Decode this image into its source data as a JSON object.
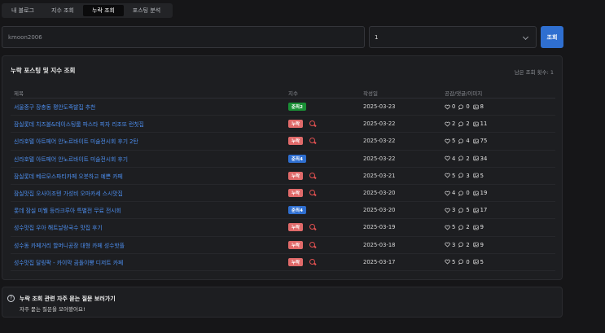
{
  "tabs": [
    {
      "label": "내 블로그"
    },
    {
      "label": "지수 조회"
    },
    {
      "label": "누락 조회"
    },
    {
      "label": "포스팅 분석"
    }
  ],
  "search": {
    "value": "kmoon2006",
    "placeholder": ""
  },
  "select": {
    "value": "1"
  },
  "search_button": "조회",
  "panel": {
    "title": "누락 포스팅 및 지수 조회",
    "remaining": "남은 조회 횟수: 1",
    "columns": [
      "제목",
      "지수",
      "작성일",
      "공감/댓글/이미지"
    ]
  },
  "colors": {
    "rank": "#1a8f35",
    "miss": "#e06a6a",
    "blue": "#2f6fd0",
    "link": "#4d8ff0"
  },
  "rows": [
    {
      "title": "서울중구 장충동 평안도족발집 추천",
      "badge": "준최2",
      "type": "rank",
      "date": "2025-03-23",
      "likes": "0",
      "comments": "0",
      "images": "8"
    },
    {
      "title": "잠실롯데 치즈볼&데이스팅룸 파스타 피자 리조또 런칫집",
      "badge": "누락",
      "type": "miss",
      "date": "2025-03-22",
      "likes": "2",
      "comments": "2",
      "images": "11"
    },
    {
      "title": "신라호텔 아트페어 안노르바이트 미술전시회 후기 2탄",
      "badge": "누락",
      "type": "miss",
      "date": "2025-03-22",
      "likes": "5",
      "comments": "4",
      "images": "75"
    },
    {
      "title": "신라호텔 아트페어 안노르바이트 미술전시회 후기",
      "badge": "준최4",
      "type": "blue",
      "date": "2025-03-22",
      "likes": "4",
      "comments": "2",
      "images": "34"
    },
    {
      "title": "잠실롯데 베르모스파티카페 오붓하고 예쁜 카페",
      "badge": "누락",
      "type": "miss",
      "date": "2025-03-21",
      "likes": "5",
      "comments": "3",
      "images": "5"
    },
    {
      "title": "잠실맛집 오사이조텐 가성비 오마카세 스시맛집",
      "badge": "누락",
      "type": "miss",
      "date": "2025-03-20",
      "likes": "4",
      "comments": "0",
      "images": "19"
    },
    {
      "title": "롯데 잠실 미웰 등라크루아 특별전 무료 전시회",
      "badge": "준최4",
      "type": "blue",
      "date": "2025-03-20",
      "likes": "3",
      "comments": "5",
      "images": "17"
    },
    {
      "title": "성수맛집 우아 해트날랑국수 맛집 후기",
      "badge": "누락",
      "type": "miss",
      "date": "2025-03-19",
      "likes": "5",
      "comments": "2",
      "images": "9"
    },
    {
      "title": "성수동 카페거리 할머니공장 대형 카페 성수핫플",
      "badge": "누락",
      "type": "miss",
      "date": "2025-03-18",
      "likes": "3",
      "comments": "2",
      "images": "9"
    },
    {
      "title": "성수맛집 달링팍 - 카이막 곰돌이빵 디저트 카페",
      "badge": "누락",
      "type": "miss",
      "date": "2025-03-17",
      "likes": "5",
      "comments": "0",
      "images": "5"
    }
  ],
  "faq": {
    "title": "누락 조회 관련 자주 묻는 질문 보러가기",
    "subtitle": "자주 묻는 질문을 모아봤어요!",
    "icon_label": "?"
  }
}
